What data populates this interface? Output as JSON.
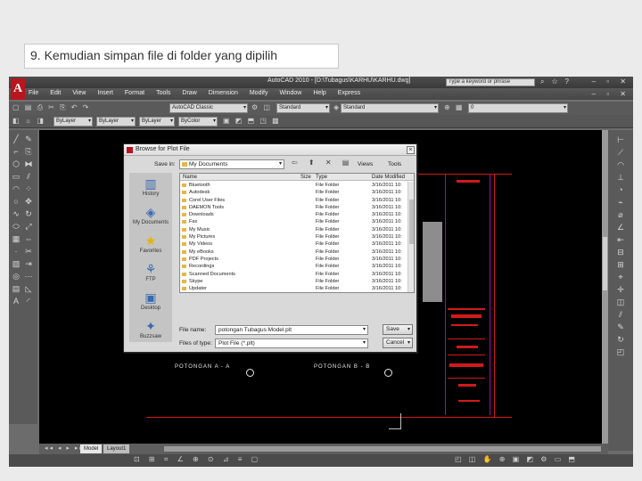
{
  "slide": {
    "title": "9. Kemudian simpan file di folder yang dipilih"
  },
  "app": {
    "logo": "A",
    "window_title": "AutoCAD 2010 - [D:\\Tubagus\\KARHU\\KARHU.dwg]",
    "search_placeholder": "Type a keyword or phrase",
    "menu": [
      "File",
      "Edit",
      "View",
      "Insert",
      "Format",
      "Tools",
      "Draw",
      "Dimension",
      "Modify",
      "Window",
      "Help",
      "Express"
    ],
    "toolbar_row1": {
      "workspace": "AutoCAD Classic",
      "layer": "0",
      "text_style": "Standard",
      "dim_style": "Standard",
      "layer_dropdown": "0"
    },
    "toolbar_row2": {
      "layer_state": "ByLayer",
      "linetype": "ByLayer",
      "lineweight": "ByLayer",
      "color": "ByColor"
    },
    "tabs": [
      "Model",
      "Layout1"
    ],
    "status_coords": "",
    "drawing": {
      "label_left": "POTONGAN A - A",
      "label_right": "POTONGAN B - B"
    }
  },
  "dialog": {
    "title": "Browse for Plot File",
    "save_in_label": "Save in:",
    "save_in_value": "My Documents",
    "tools_label": "Views",
    "tools2_label": "Tools",
    "places": [
      "History",
      "My Documents",
      "Favorites",
      "Desktop",
      "FTP",
      "Buzzsaw"
    ],
    "columns": [
      "Name",
      "Size",
      "Type",
      "Date Modified"
    ],
    "files": [
      {
        "name": "Bluetooth",
        "type": "File Folder",
        "date": "3/16/2011 10:"
      },
      {
        "name": "Autodesk",
        "type": "File Folder",
        "date": "3/16/2011 10:"
      },
      {
        "name": "Corel User Files",
        "type": "File Folder",
        "date": "3/16/2011 10:"
      },
      {
        "name": "DAEMON Tools",
        "type": "File Folder",
        "date": "3/16/2011 10:"
      },
      {
        "name": "Downloads",
        "type": "File Folder",
        "date": "3/16/2011 10:"
      },
      {
        "name": "Fax",
        "type": "File Folder",
        "date": "3/16/2011 10:"
      },
      {
        "name": "My Music",
        "type": "File Folder",
        "date": "3/16/2011 10:"
      },
      {
        "name": "My Pictures",
        "type": "File Folder",
        "date": "3/16/2011 10:"
      },
      {
        "name": "My Videos",
        "type": "File Folder",
        "date": "3/16/2011 10:"
      },
      {
        "name": "My eBooks",
        "type": "File Folder",
        "date": "3/16/2011 10:"
      },
      {
        "name": "PDF Projects",
        "type": "File Folder",
        "date": "3/16/2011 10:"
      },
      {
        "name": "Recordings",
        "type": "File Folder",
        "date": "3/16/2011 10:"
      },
      {
        "name": "Scanned Documents",
        "type": "File Folder",
        "date": "3/16/2011 10:"
      },
      {
        "name": "Skype",
        "type": "File Folder",
        "date": "3/16/2011 10:"
      },
      {
        "name": "Updater",
        "type": "File Folder",
        "date": "3/16/2011 10:"
      }
    ],
    "file_name_label": "File name:",
    "file_name_value": "potongan Tubagus Model.plt",
    "file_type_label": "Files of type:",
    "file_type_value": "Plot File (*.plt)",
    "save_button": "Save",
    "cancel_button": "Cancel"
  }
}
